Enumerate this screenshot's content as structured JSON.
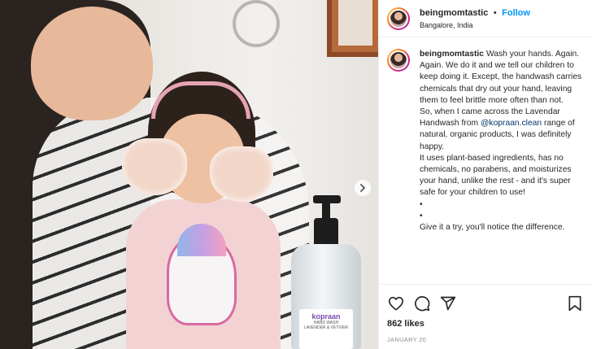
{
  "header": {
    "username": "beingmomtastic",
    "separator": "•",
    "follow_label": "Follow",
    "location": "Bangalore, India"
  },
  "photo": {
    "next_icon": "chevron-right-icon",
    "bottle_brand": "kopraan",
    "bottle_product": "HAND WASH",
    "bottle_variant": "LAVENDER & VETIVER"
  },
  "caption": {
    "username": "beingmomtastic",
    "line1": "Wash your hands. Again. Again. We do it and we tell our children to keep doing it. Except, the handwash carries chemicals that dry out your hand, leaving them to feel brittle more often than not.",
    "line2_pre": "So, when I came across the Lavendar Handwash from ",
    "mention": "@kopraan.clean",
    "line2_post": " range of natural, organic products, I was definitely happy.",
    "line3": "It uses plant-based ingredients, has no chemicals, no parabens, and moisturizes your hand, unlike the rest - and it's super safe for your children to use!",
    "bullet1": "•",
    "bullet2": "•",
    "line4": "Give it a try, you'll notice the difference."
  },
  "actions": {
    "like_icon": "heart-icon",
    "comment_icon": "comment-icon",
    "share_icon": "share-icon",
    "save_icon": "bookmark-icon",
    "likes": "862 likes",
    "date": "JANUARY 20"
  },
  "colors": {
    "follow": "#0095f6",
    "mention": "#00376b",
    "muted": "#8e8e8e",
    "text": "#262626"
  }
}
